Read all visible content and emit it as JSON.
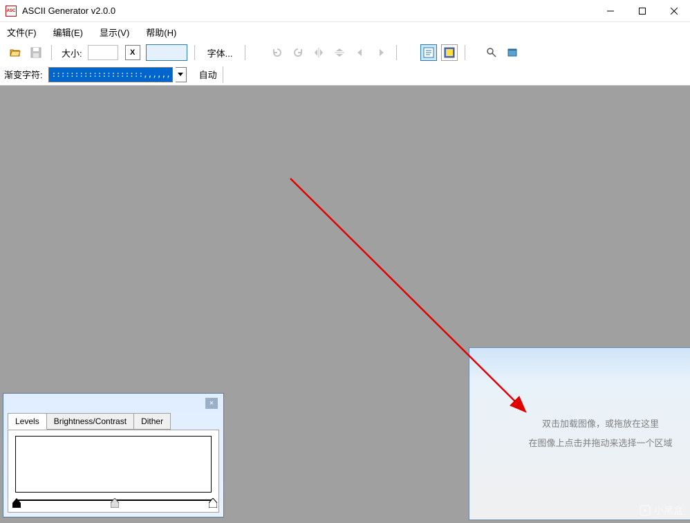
{
  "titlebar": {
    "title": "ASCII Generator v2.0.0",
    "icon_text": "ASC\nGEN"
  },
  "menubar": {
    "file": "文件(F)",
    "edit": "编辑(E)",
    "view": "显示(V)",
    "help": "帮助(H)"
  },
  "toolbar": {
    "size_label": "大小:",
    "size_value": "",
    "lock_label": "X",
    "font_label": "字体...",
    "ramp_label": "渐变字符:",
    "ramp_value": "::::::::::::::::::::,,,,,,,,,,,,,",
    "auto_label": "自动"
  },
  "levels_panel": {
    "tabs": [
      {
        "label": "Levels",
        "active": true
      },
      {
        "label": "Brightness/Contrast",
        "active": false
      },
      {
        "label": "Dither",
        "active": false
      }
    ],
    "close": "×"
  },
  "drop_panel": {
    "line1": "双击加载图像，或拖放在这里",
    "line2": "在图像上点击并拖动来选择一个区域"
  },
  "watermark": "小黑盒"
}
